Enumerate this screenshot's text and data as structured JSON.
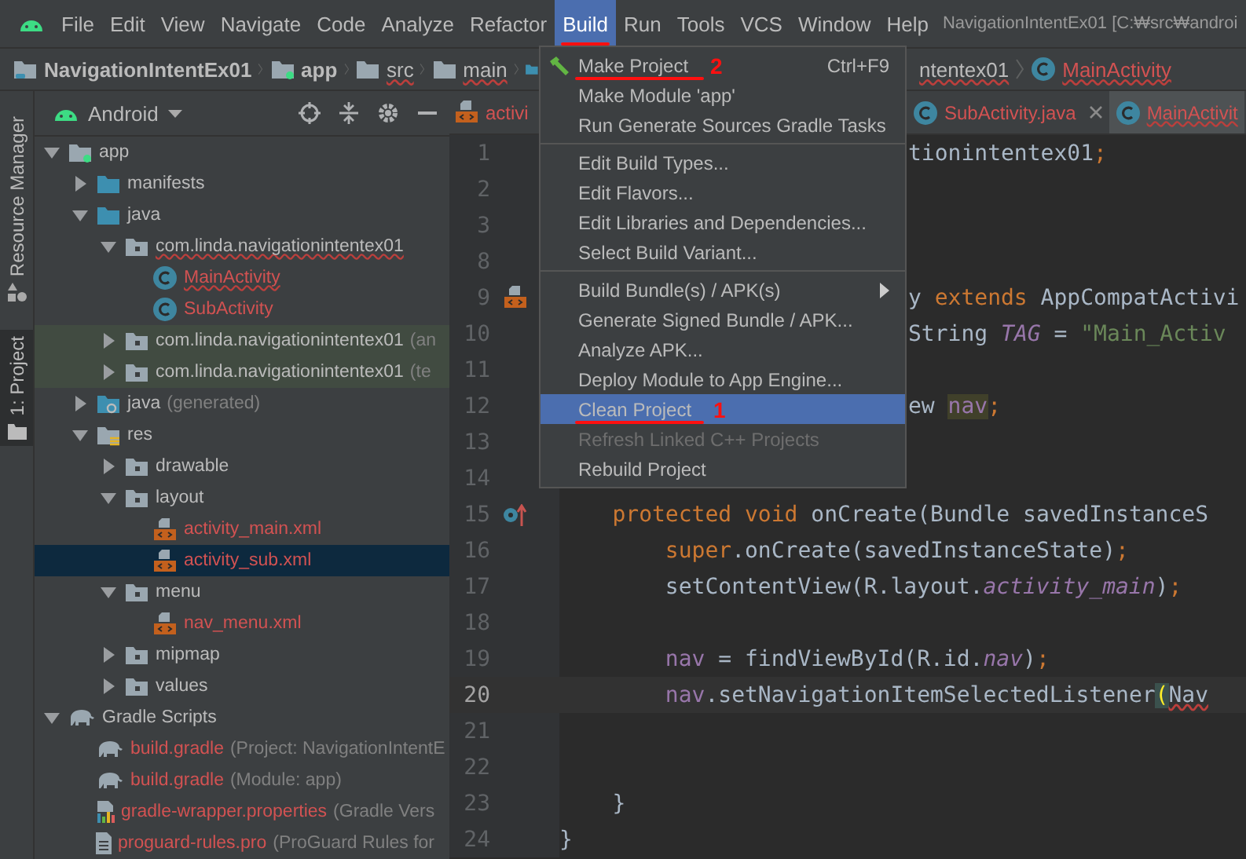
{
  "menubar": {
    "items": [
      {
        "label": "File",
        "selected": false,
        "underlined": false
      },
      {
        "label": "Edit",
        "selected": false,
        "underlined": false
      },
      {
        "label": "View",
        "selected": false,
        "underlined": false
      },
      {
        "label": "Navigate",
        "selected": false,
        "underlined": false
      },
      {
        "label": "Code",
        "selected": false,
        "underlined": false
      },
      {
        "label": "Analyze",
        "selected": false,
        "underlined": false
      },
      {
        "label": "Refactor",
        "selected": false,
        "underlined": false
      },
      {
        "label": "Build",
        "selected": true,
        "underlined": true
      },
      {
        "label": "Run",
        "selected": false,
        "underlined": false
      },
      {
        "label": "Tools",
        "selected": false,
        "underlined": false
      },
      {
        "label": "VCS",
        "selected": false,
        "underlined": false
      },
      {
        "label": "Window",
        "selected": false,
        "underlined": false
      },
      {
        "label": "Help",
        "selected": false,
        "underlined": false
      }
    ],
    "title": "NavigationIntentEx01 [C:₩src₩androi"
  },
  "breadcrumb": {
    "left": [
      {
        "label": "NavigationIntentEx01",
        "kind": "project",
        "wavy": false,
        "red": false
      },
      {
        "label": "app",
        "kind": "module",
        "wavy": false,
        "red": false
      },
      {
        "label": "src",
        "kind": "folder",
        "wavy": true,
        "red": false
      },
      {
        "label": "main",
        "kind": "folder",
        "wavy": true,
        "red": false
      },
      {
        "kind": "blue-folder"
      }
    ],
    "right": [
      {
        "label": "ntentex01",
        "kind": "none",
        "wavy": true,
        "red": false
      },
      {
        "label": "MainActivity",
        "kind": "class",
        "wavy": true,
        "red": true
      }
    ]
  },
  "tool_strip": [
    {
      "label": "Resource Manager",
      "kind": "resources",
      "selected": false
    },
    {
      "label": "1: Project",
      "kind": "project",
      "selected": true
    }
  ],
  "project_panel": {
    "view": "Android",
    "tree": [
      {
        "label": "app",
        "kind": "module",
        "expanded": true,
        "red": false,
        "selected": false,
        "children": [
          {
            "label": "manifests",
            "kind": "source-folder",
            "expanded": false,
            "red": false,
            "selected": false
          },
          {
            "label": "java",
            "kind": "source-folder",
            "expanded": true,
            "red": false,
            "selected": false,
            "children": [
              {
                "label": "com.linda.navigationintentex01",
                "kind": "package",
                "expanded": true,
                "wavy": true,
                "red": false,
                "selected": false,
                "children": [
                  {
                    "label": "MainActivity",
                    "kind": "class",
                    "wavy": true,
                    "red": true,
                    "selected": false
                  },
                  {
                    "label": "SubActivity",
                    "kind": "class",
                    "wavy": false,
                    "red": true,
                    "selected": false
                  }
                ]
              },
              {
                "label": "com.linda.navigationintentex01",
                "suffix": "(an",
                "kind": "package",
                "expanded": false,
                "tinted": true,
                "red": false,
                "selected": false
              },
              {
                "label": "com.linda.navigationintentex01",
                "suffix": "(te",
                "kind": "package",
                "expanded": false,
                "tinted": true,
                "red": false,
                "selected": false
              }
            ]
          },
          {
            "label": "java",
            "suffix": "(generated)",
            "kind": "generated",
            "expanded": false,
            "red": false,
            "selected": false
          },
          {
            "label": "res",
            "kind": "resources",
            "expanded": true,
            "red": false,
            "selected": false,
            "children": [
              {
                "label": "drawable",
                "kind": "package",
                "expanded": false,
                "red": false,
                "selected": false
              },
              {
                "label": "layout",
                "kind": "package",
                "expanded": true,
                "red": false,
                "selected": false,
                "children": [
                  {
                    "label": "activity_main.xml",
                    "kind": "xml",
                    "red": true,
                    "selected": false
                  },
                  {
                    "label": "activity_sub.xml",
                    "kind": "xml",
                    "red": true,
                    "selected": true
                  }
                ]
              },
              {
                "label": "menu",
                "kind": "package",
                "expanded": true,
                "red": false,
                "selected": false,
                "children": [
                  {
                    "label": "nav_menu.xml",
                    "kind": "xml",
                    "red": true,
                    "selected": false
                  }
                ]
              },
              {
                "label": "mipmap",
                "kind": "package",
                "expanded": false,
                "red": false,
                "selected": false
              },
              {
                "label": "values",
                "kind": "package",
                "expanded": false,
                "red": false,
                "selected": false
              }
            ]
          }
        ]
      },
      {
        "label": "Gradle Scripts",
        "kind": "gradle",
        "expanded": true,
        "red": false,
        "selected": false,
        "children": [
          {
            "label": "build.gradle",
            "suffix": "(Project: NavigationIntentE",
            "kind": "gradle",
            "red": true,
            "selected": false
          },
          {
            "label": "build.gradle",
            "suffix": "(Module: app)",
            "kind": "gradle",
            "red": true,
            "selected": false
          },
          {
            "label": "gradle-wrapper.properties",
            "suffix": "(Gradle Vers",
            "kind": "properties",
            "red": true,
            "selected": false
          },
          {
            "label": "proguard-rules.pro",
            "suffix": "(ProGuard Rules for",
            "kind": "file",
            "red": true,
            "selected": false
          }
        ]
      }
    ]
  },
  "editor": {
    "tabs_left": [
      {
        "label": "activi",
        "kind": "xml",
        "red": true,
        "selected": false
      }
    ],
    "tabs_right": [
      {
        "label": "SubActivity.java",
        "kind": "class",
        "red": true,
        "selected": false,
        "closable": true
      },
      {
        "label": "MainActivit",
        "kind": "class",
        "red": true,
        "selected": true,
        "closable": false
      }
    ],
    "lines": [
      {
        "number": "1",
        "current": false,
        "behind_menu": true,
        "tokens": [
          {
            "text": "tionintentex01",
            "kind": "plain"
          },
          {
            "text": ";",
            "kind": "keyword"
          }
        ]
      },
      {
        "number": "2",
        "current": false
      },
      {
        "number": "3",
        "current": false
      },
      {
        "number": "8",
        "current": false
      },
      {
        "number": "9",
        "current": false,
        "gutter_marker": {
          "kind": "xml"
        },
        "behind_menu": true,
        "tokens": [
          {
            "text": "y ",
            "kind": "plain"
          },
          {
            "text": "extends",
            "kind": "keyword"
          },
          {
            "text": " AppCompatActivi",
            "kind": "plain"
          }
        ]
      },
      {
        "number": "10",
        "current": false,
        "behind_menu": true,
        "tokens": [
          {
            "text": "String ",
            "kind": "plain"
          },
          {
            "text": "TAG",
            "kind": "static"
          },
          {
            "text": " = ",
            "kind": "plain"
          },
          {
            "text": "\"Main_Activ",
            "kind": "string"
          }
        ]
      },
      {
        "number": "11",
        "current": false
      },
      {
        "number": "12",
        "current": false,
        "behind_menu": true,
        "tokens": [
          {
            "text": "ew ",
            "kind": "plain"
          },
          {
            "text": "nav",
            "kind": "usage"
          },
          {
            "text": ";",
            "kind": "keyword"
          }
        ]
      },
      {
        "number": "13",
        "current": false
      },
      {
        "number": "14",
        "current": false
      },
      {
        "number": "15",
        "current": false,
        "gutter_marker": {
          "kind": "override"
        },
        "tokens": [
          {
            "text": "    protected void ",
            "kind": "keyword"
          },
          {
            "text": "onCreate(Bundle savedInstanceS",
            "kind": "plain"
          }
        ]
      },
      {
        "number": "16",
        "current": false,
        "tokens": [
          {
            "text": "        super",
            "kind": "keyword"
          },
          {
            "text": ".onCreate(savedInstanceState)",
            "kind": "plain"
          },
          {
            "text": ";",
            "kind": "keyword"
          }
        ]
      },
      {
        "number": "17",
        "current": false,
        "tokens": [
          {
            "text": "        setContentView(R.layout.",
            "kind": "plain"
          },
          {
            "text": "activity_main",
            "kind": "field-italic"
          },
          {
            "text": ")",
            "kind": "plain"
          },
          {
            "text": ";",
            "kind": "keyword"
          }
        ]
      },
      {
        "number": "18",
        "current": false
      },
      {
        "number": "19",
        "current": false,
        "tokens": [
          {
            "text": "        nav",
            "kind": "field"
          },
          {
            "text": " = findViewById(R.id.",
            "kind": "plain"
          },
          {
            "text": "nav",
            "kind": "field-italic"
          },
          {
            "text": ")",
            "kind": "plain"
          },
          {
            "text": ";",
            "kind": "keyword"
          }
        ]
      },
      {
        "number": "20",
        "current": true,
        "tokens": [
          {
            "text": "        nav",
            "kind": "field"
          },
          {
            "text": ".setNavigationItemSelectedListener",
            "kind": "plain"
          },
          {
            "text": "(",
            "kind": "brace"
          },
          {
            "text": "Nav",
            "kind": "error"
          }
        ]
      },
      {
        "number": "21",
        "current": false
      },
      {
        "number": "22",
        "current": false
      },
      {
        "number": "23",
        "current": false,
        "tokens": [
          {
            "text": "    }",
            "kind": "plain"
          }
        ]
      },
      {
        "number": "24",
        "current": false,
        "tokens": [
          {
            "text": "}",
            "kind": "plain"
          }
        ]
      }
    ]
  },
  "build_menu": {
    "groups": [
      [
        {
          "label": "Make Project",
          "shortcut": "Ctrl+F9",
          "annotation": "2",
          "selected": false,
          "disabled": false,
          "submenu": false
        },
        {
          "label": "Make Module 'app'",
          "selected": false,
          "disabled": false,
          "submenu": false
        },
        {
          "label": "Run Generate Sources Gradle Tasks",
          "selected": false,
          "disabled": false,
          "submenu": false
        }
      ],
      [
        {
          "label": "Edit Build Types...",
          "selected": false,
          "disabled": false,
          "submenu": false
        },
        {
          "label": "Edit Flavors...",
          "selected": false,
          "disabled": false,
          "submenu": false
        },
        {
          "label": "Edit Libraries and Dependencies...",
          "selected": false,
          "disabled": false,
          "submenu": false
        },
        {
          "label": "Select Build Variant...",
          "selected": false,
          "disabled": false,
          "submenu": false
        }
      ],
      [
        {
          "label": "Build Bundle(s) / APK(s)",
          "selected": false,
          "disabled": false,
          "submenu": true
        },
        {
          "label": "Generate Signed Bundle / APK...",
          "selected": false,
          "disabled": false,
          "submenu": false
        },
        {
          "label": "Analyze APK...",
          "selected": false,
          "disabled": false,
          "submenu": false
        },
        {
          "label": "Deploy Module to App Engine...",
          "selected": false,
          "disabled": false,
          "submenu": false
        },
        {
          "label": "Clean Project",
          "annotation": "1",
          "selected": true,
          "disabled": false,
          "submenu": false
        },
        {
          "label": "Refresh Linked C++ Projects",
          "selected": false,
          "disabled": true,
          "submenu": false
        },
        {
          "label": "Rebuild Project",
          "selected": false,
          "disabled": false,
          "submenu": false
        }
      ]
    ]
  }
}
